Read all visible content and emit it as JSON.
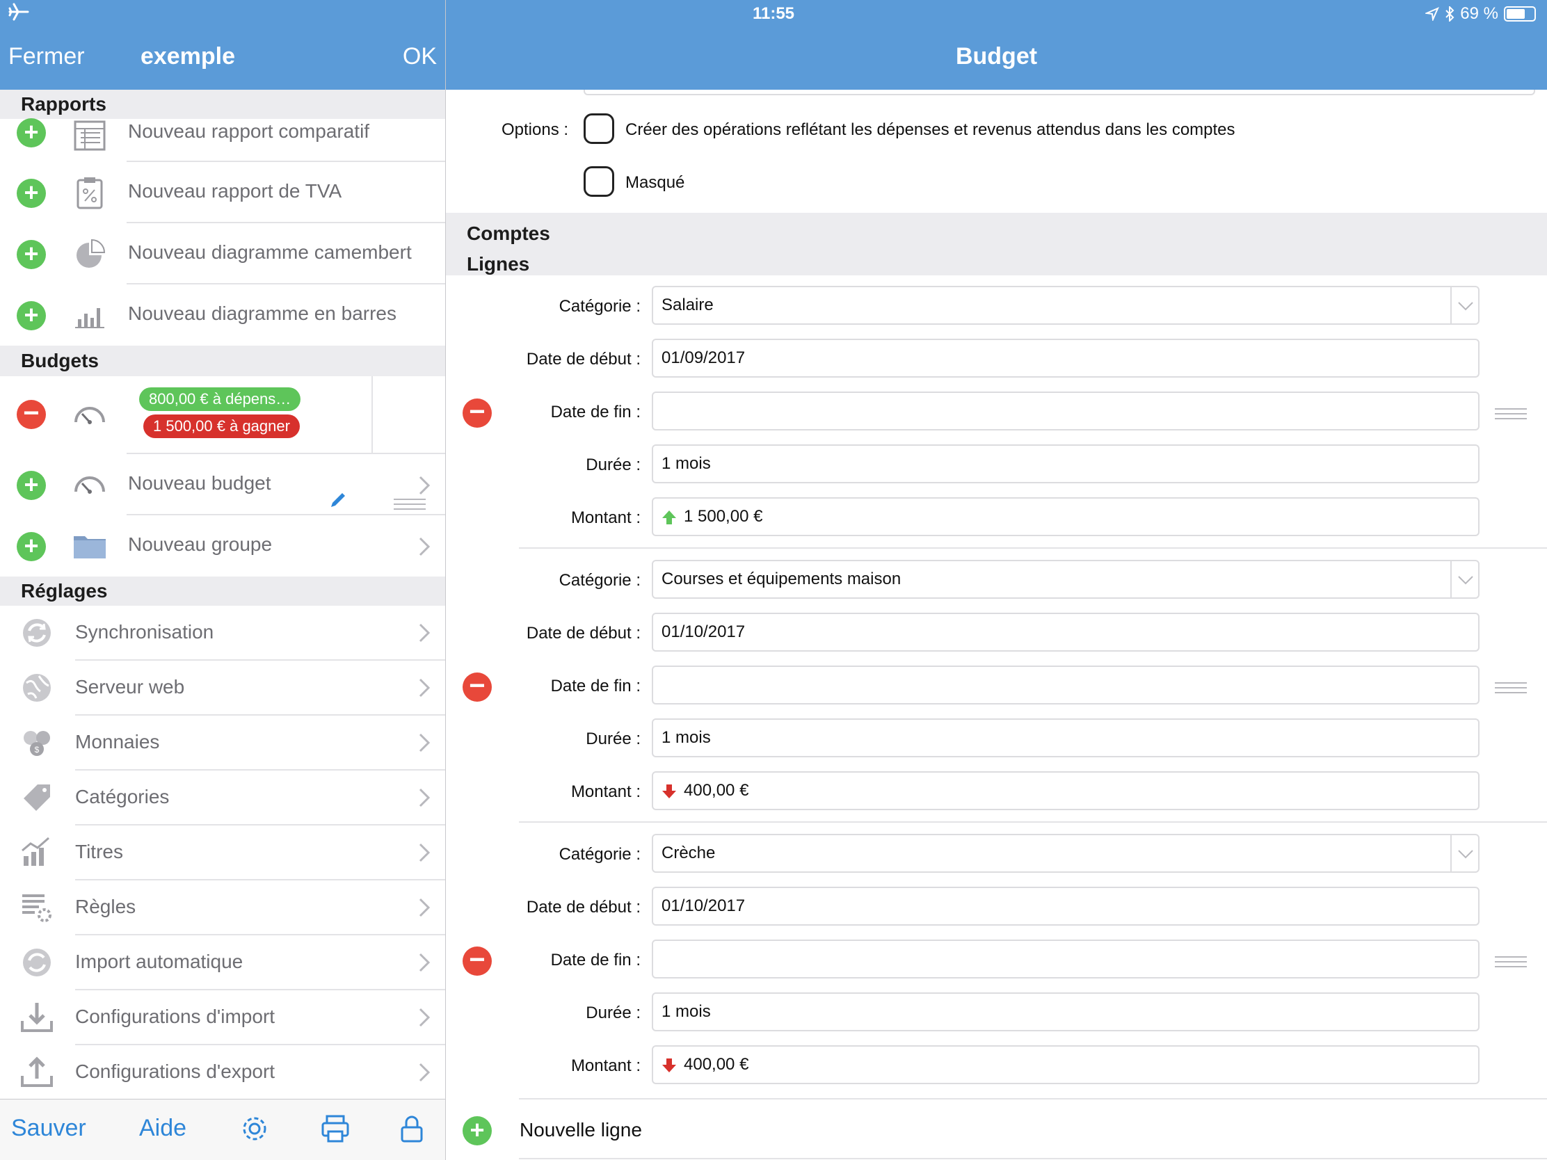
{
  "status": {
    "time": "11:55",
    "battery": "69 %",
    "battery_level": 0.69
  },
  "left_nav": {
    "close": "Fermer",
    "title": "exemple",
    "ok": "OK"
  },
  "right_nav": {
    "title": "Budget"
  },
  "reports": {
    "header": "Rapports",
    "items": [
      {
        "label": "Nouveau rapport comparatif",
        "icon": "comparative-report-icon"
      },
      {
        "label": "Nouveau rapport de TVA",
        "icon": "vat-report-icon"
      },
      {
        "label": "Nouveau diagramme camembert",
        "icon": "pie-chart-icon"
      },
      {
        "label": "Nouveau diagramme en barres",
        "icon": "bar-chart-icon"
      }
    ]
  },
  "budgets": {
    "header": "Budgets",
    "existing": {
      "spend": "800,00 € à dépens…",
      "earn": "1 500,00 € à gagner"
    },
    "new_budget": "Nouveau budget",
    "new_group": "Nouveau groupe"
  },
  "settings": {
    "header": "Réglages",
    "items": [
      {
        "label": "Synchronisation",
        "icon": "sync-icon"
      },
      {
        "label": "Serveur web",
        "icon": "globe-icon"
      },
      {
        "label": "Monnaies",
        "icon": "coins-icon"
      },
      {
        "label": "Catégories",
        "icon": "tag-icon"
      },
      {
        "label": "Titres",
        "icon": "stocks-icon"
      },
      {
        "label": "Règles",
        "icon": "rules-icon"
      },
      {
        "label": "Import automatique",
        "icon": "auto-import-icon"
      },
      {
        "label": "Configurations d'import",
        "icon": "import-icon"
      },
      {
        "label": "Configurations d'export",
        "icon": "export-icon"
      }
    ]
  },
  "toolbar": {
    "save": "Sauver",
    "help": "Aide"
  },
  "options": {
    "label": "Options :",
    "create_ops": "Créer des opérations reflétant les dépenses et revenus attendus dans les comptes",
    "hidden": "Masqué"
  },
  "sections": {
    "accounts": "Comptes",
    "lines": "Lignes"
  },
  "field_labels": {
    "category": "Catégorie :",
    "start": "Date de début :",
    "end": "Date de fin :",
    "duration": "Durée :",
    "amount": "Montant :"
  },
  "lines": [
    {
      "category": "Salaire",
      "start": "01/09/2017",
      "end": "",
      "duration": "1 mois",
      "amount": "1 500,00 €",
      "direction": "up"
    },
    {
      "category": "Courses et équipements maison",
      "start": "01/10/2017",
      "end": "",
      "duration": "1 mois",
      "amount": "400,00 €",
      "direction": "down"
    },
    {
      "category": "Crèche",
      "start": "01/10/2017",
      "end": "",
      "duration": "1 mois",
      "amount": "400,00 €",
      "direction": "down"
    }
  ],
  "new_line": "Nouvelle ligne",
  "colors": {
    "nav": "#5b9bd8",
    "green": "#5ec55a",
    "red": "#e8483a",
    "link": "#2e86d8"
  }
}
